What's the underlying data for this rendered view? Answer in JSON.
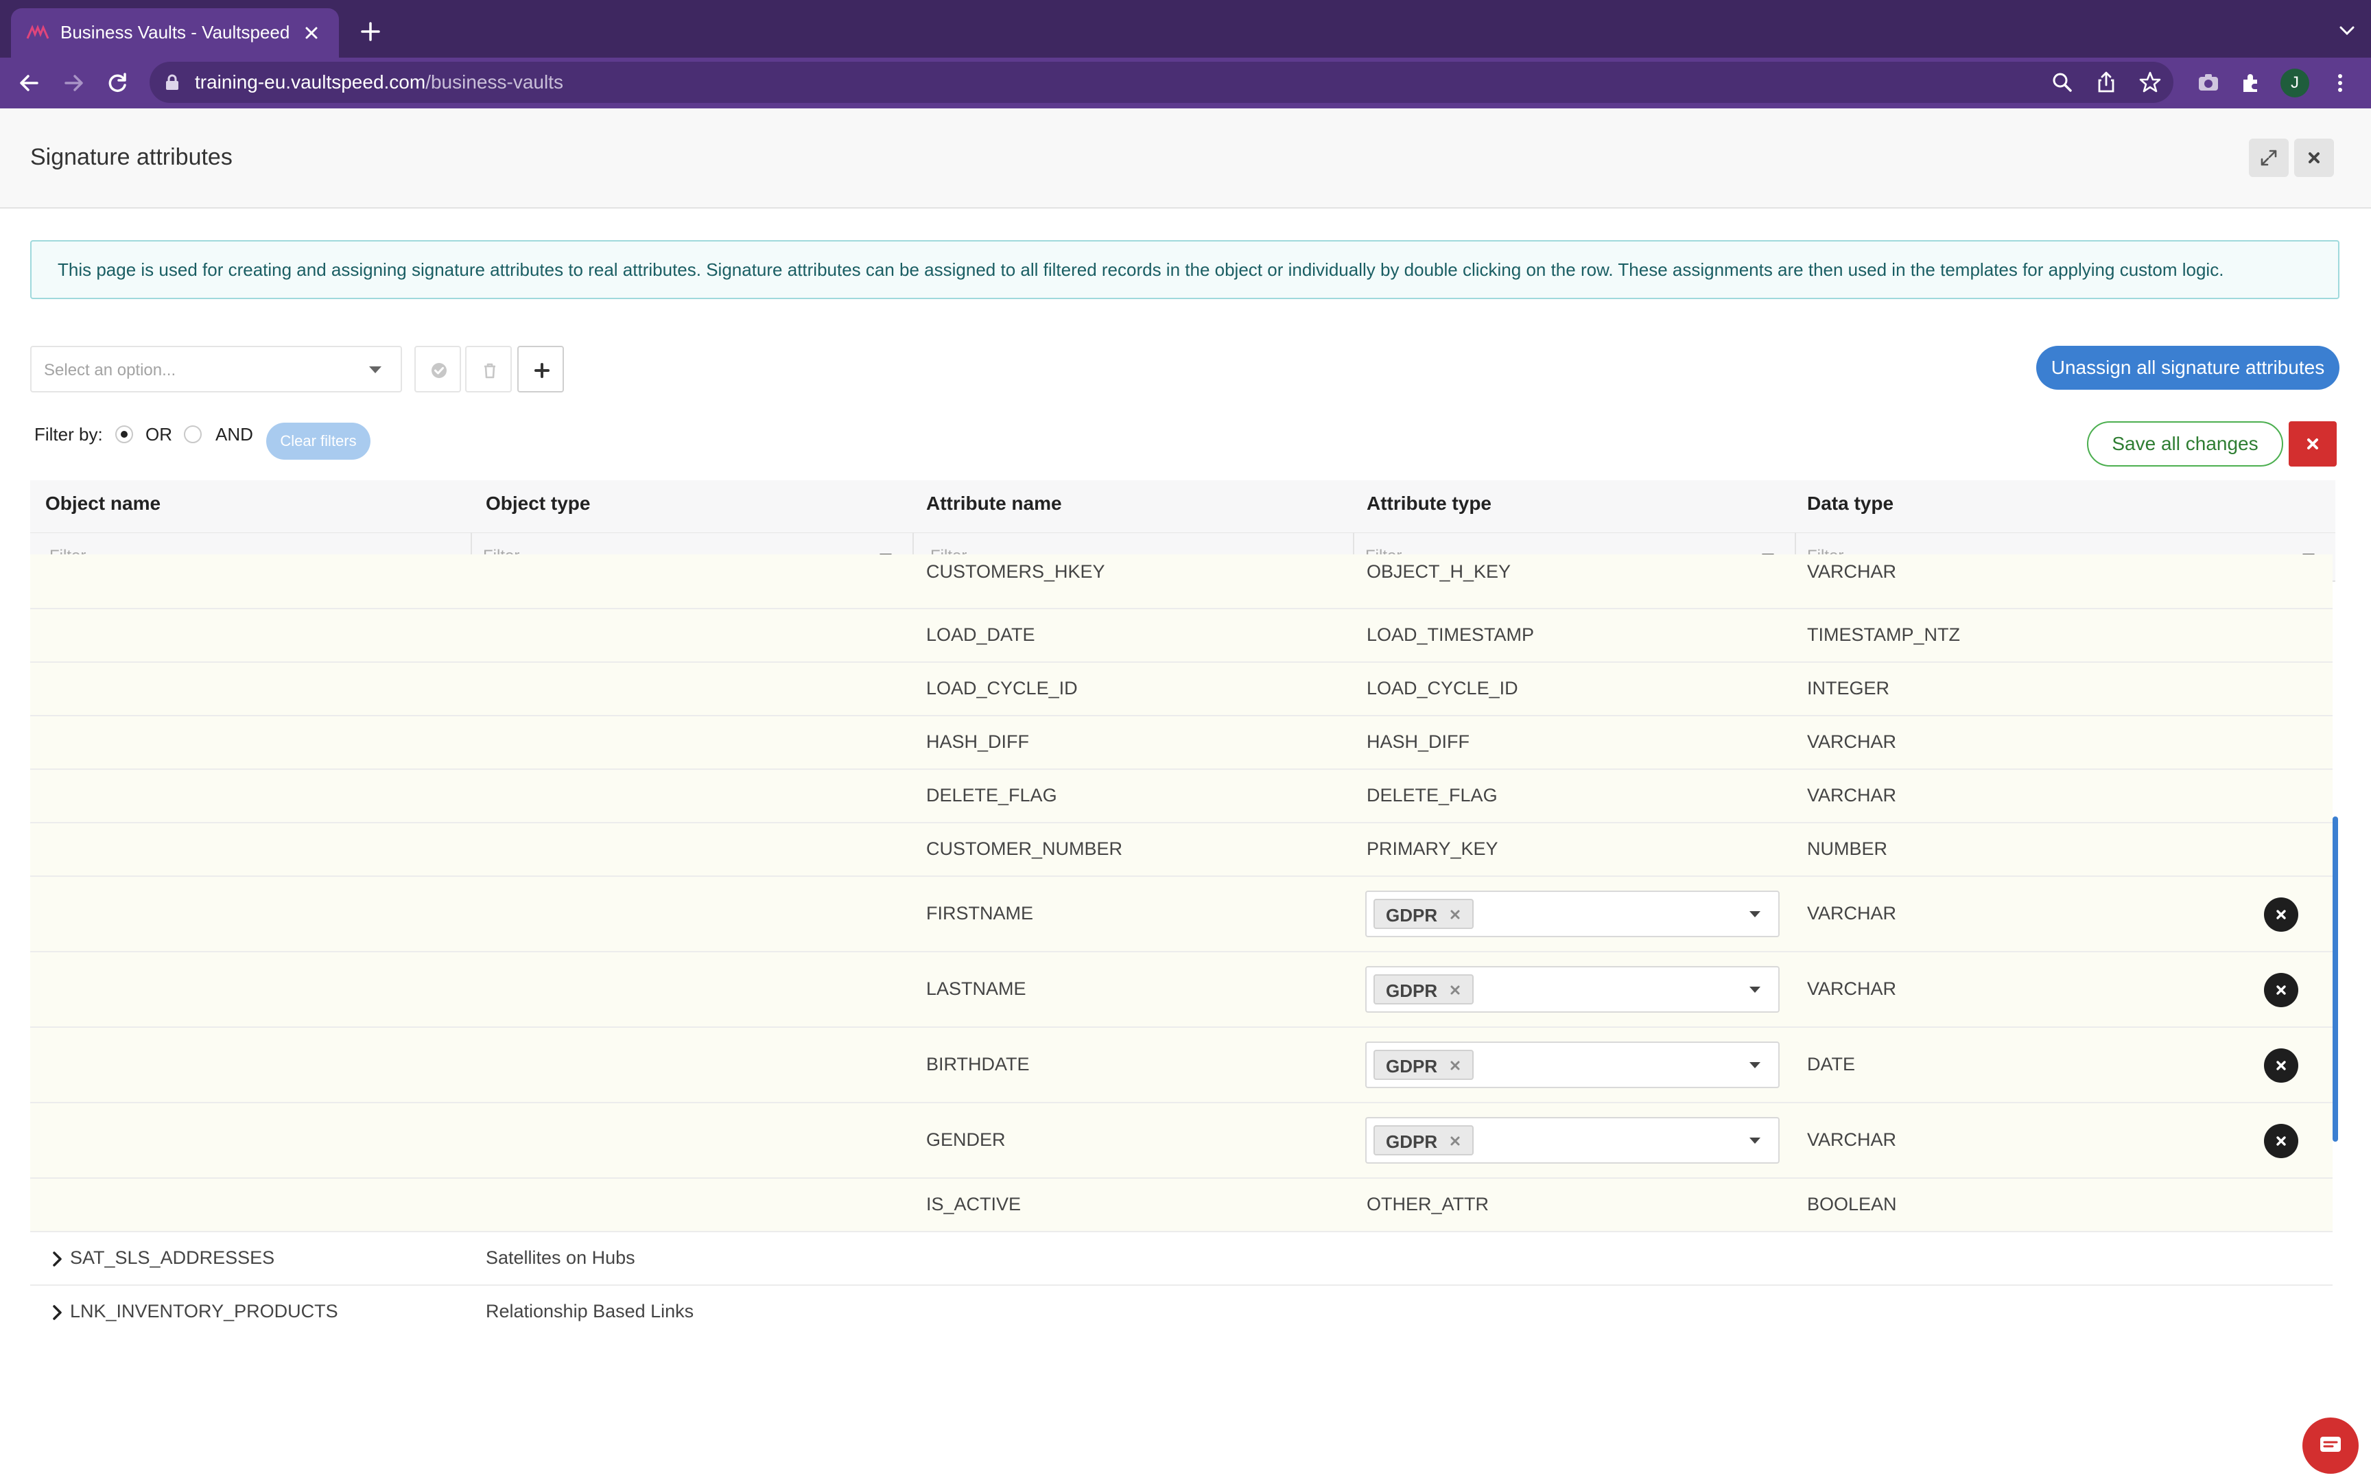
{
  "browser": {
    "tab_title": "Business Vaults - Vaultspeed",
    "url_domain": "training-eu.vaultspeed.com",
    "url_path": "/business-vaults",
    "profile_initial": "J"
  },
  "modal": {
    "title": "Signature attributes"
  },
  "info_text": "This page is used for creating and assigning signature attributes to real attributes. Signature attributes can be assigned to all filtered records in the object or individually by double clicking on the row. These assignments are then used in the templates for applying custom logic.",
  "controls": {
    "select_placeholder": "Select an option...",
    "unassign_label": "Unassign all signature attributes",
    "filter_by_label": "Filter by:",
    "or_label": "OR",
    "and_label": "AND",
    "filter_mode": "OR",
    "clear_filters_label": "Clear filters",
    "save_label": "Save all changes"
  },
  "grid": {
    "columns": [
      {
        "label": "Object name",
        "filter_placeholder": "Filter..."
      },
      {
        "label": "Object type",
        "filter_placeholder": "Filter..."
      },
      {
        "label": "Attribute name",
        "filter_placeholder": "Filter..."
      },
      {
        "label": "Attribute type",
        "filter_placeholder": "Filter..."
      },
      {
        "label": "Data type",
        "filter_placeholder": "Filter..."
      }
    ],
    "rows": [
      {
        "attribute_name": "CUSTOMERS_HKEY",
        "attribute_type": "OBJECT_H_KEY",
        "data_type": "VARCHAR"
      },
      {
        "attribute_name": "LOAD_DATE",
        "attribute_type": "LOAD_TIMESTAMP",
        "data_type": "TIMESTAMP_NTZ"
      },
      {
        "attribute_name": "LOAD_CYCLE_ID",
        "attribute_type": "LOAD_CYCLE_ID",
        "data_type": "INTEGER"
      },
      {
        "attribute_name": "HASH_DIFF",
        "attribute_type": "HASH_DIFF",
        "data_type": "VARCHAR"
      },
      {
        "attribute_name": "DELETE_FLAG",
        "attribute_type": "DELETE_FLAG",
        "data_type": "VARCHAR"
      },
      {
        "attribute_name": "CUSTOMER_NUMBER",
        "attribute_type": "PRIMARY_KEY",
        "data_type": "NUMBER"
      },
      {
        "attribute_name": "FIRSTNAME",
        "tag": "GDPR",
        "data_type": "VARCHAR"
      },
      {
        "attribute_name": "LASTNAME",
        "tag": "GDPR",
        "data_type": "VARCHAR"
      },
      {
        "attribute_name": "BIRTHDATE",
        "tag": "GDPR",
        "data_type": "DATE"
      },
      {
        "attribute_name": "GENDER",
        "tag": "GDPR",
        "data_type": "VARCHAR"
      },
      {
        "attribute_name": "IS_ACTIVE",
        "attribute_type": "OTHER_ATTR",
        "data_type": "BOOLEAN"
      }
    ],
    "groups": [
      {
        "object_name": "SAT_SLS_ADDRESSES",
        "object_type": "Satellites on Hubs"
      },
      {
        "object_name": "LNK_INVENTORY_PRODUCTS",
        "object_type": "Relationship Based Links"
      }
    ]
  }
}
